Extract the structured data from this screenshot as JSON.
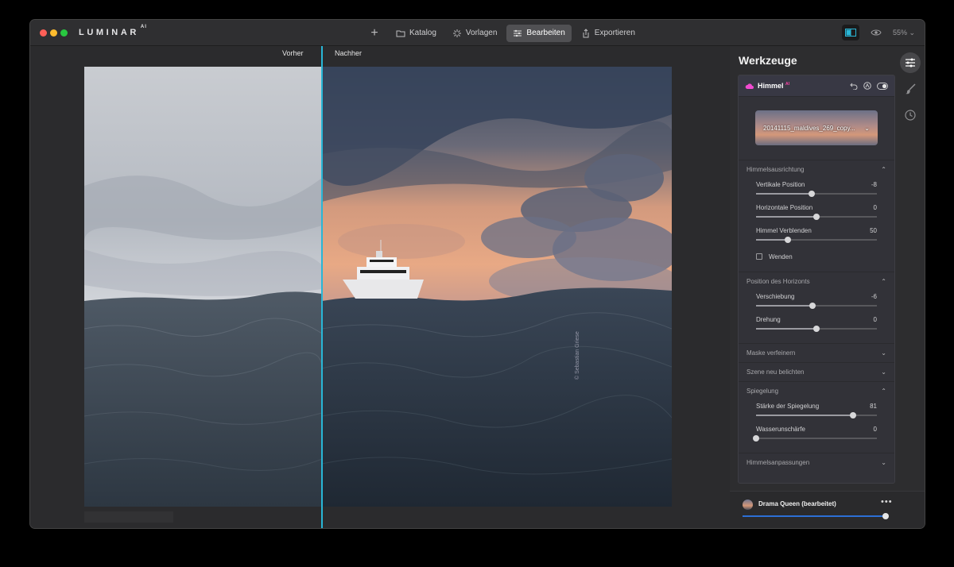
{
  "app": {
    "logo": "LUMINAR",
    "logo_sup": "AI"
  },
  "nav": {
    "items": [
      {
        "label": "Katalog",
        "icon": "folder-icon"
      },
      {
        "label": "Vorlagen",
        "icon": "sparkle-icon"
      },
      {
        "label": "Bearbeiten",
        "icon": "sliders-icon",
        "active": true
      },
      {
        "label": "Exportieren",
        "icon": "export-icon"
      }
    ]
  },
  "toolbar": {
    "zoom": "55%"
  },
  "canvas": {
    "before_label": "Vorher",
    "after_label": "Nachher",
    "watermark": "© Sebastian Griese"
  },
  "panel": {
    "title": "Werkzeuge",
    "tool": {
      "name": "Himmel",
      "badge": "AI",
      "sky_file": "20141115_maldives_269_copy..."
    },
    "sections": {
      "himmelsausrichtung": {
        "title": "Himmelsausrichtung",
        "sliders": [
          {
            "label": "Vertikale Position",
            "value": "-8",
            "level": 0.46
          },
          {
            "label": "Horizontale Position",
            "value": "0",
            "level": 0.5
          },
          {
            "label": "Himmel Verblenden",
            "value": "50",
            "level": 0.26
          }
        ],
        "checkbox": "Wenden"
      },
      "horizont": {
        "title": "Position des Horizonts",
        "sliders": [
          {
            "label": "Verschiebung",
            "value": "-6",
            "level": 0.47
          },
          {
            "label": "Drehung",
            "value": "0",
            "level": 0.5
          }
        ]
      },
      "maske": {
        "title": "Maske verfeinern"
      },
      "szene": {
        "title": "Szene neu belichten"
      },
      "spiegelung": {
        "title": "Spiegelung",
        "sliders": [
          {
            "label": "Stärke der Spiegelung",
            "value": "81",
            "level": 0.8
          },
          {
            "label": "Wasserunschärfe",
            "value": "0",
            "level": 0.0
          }
        ]
      },
      "anpassungen": {
        "title": "Himmelsanpassungen"
      }
    },
    "preset": {
      "name": "Drama Queen (bearbeitet)",
      "more": "•••",
      "level": 1.0
    }
  }
}
